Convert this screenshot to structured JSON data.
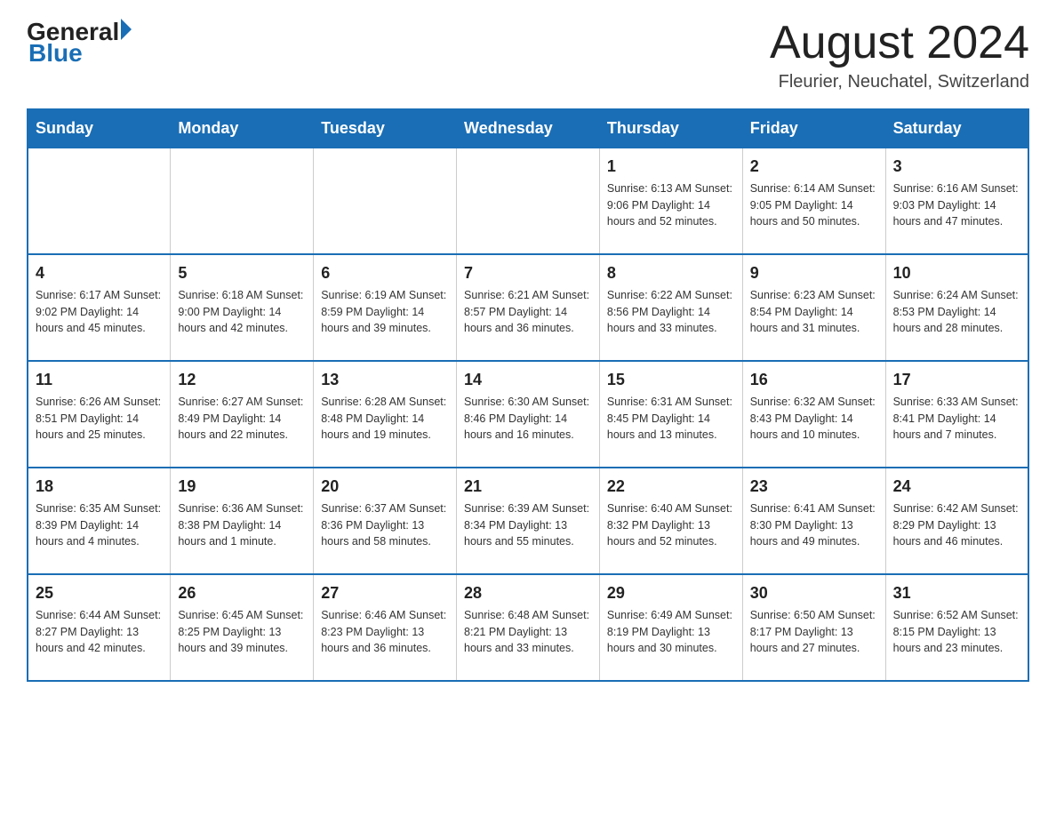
{
  "header": {
    "logo_general": "General",
    "logo_blue": "Blue",
    "month_title": "August 2024",
    "location": "Fleurier, Neuchatel, Switzerland"
  },
  "weekdays": [
    "Sunday",
    "Monday",
    "Tuesday",
    "Wednesday",
    "Thursday",
    "Friday",
    "Saturday"
  ],
  "weeks": [
    [
      {
        "day": "",
        "info": ""
      },
      {
        "day": "",
        "info": ""
      },
      {
        "day": "",
        "info": ""
      },
      {
        "day": "",
        "info": ""
      },
      {
        "day": "1",
        "info": "Sunrise: 6:13 AM\nSunset: 9:06 PM\nDaylight: 14 hours\nand 52 minutes."
      },
      {
        "day": "2",
        "info": "Sunrise: 6:14 AM\nSunset: 9:05 PM\nDaylight: 14 hours\nand 50 minutes."
      },
      {
        "day": "3",
        "info": "Sunrise: 6:16 AM\nSunset: 9:03 PM\nDaylight: 14 hours\nand 47 minutes."
      }
    ],
    [
      {
        "day": "4",
        "info": "Sunrise: 6:17 AM\nSunset: 9:02 PM\nDaylight: 14 hours\nand 45 minutes."
      },
      {
        "day": "5",
        "info": "Sunrise: 6:18 AM\nSunset: 9:00 PM\nDaylight: 14 hours\nand 42 minutes."
      },
      {
        "day": "6",
        "info": "Sunrise: 6:19 AM\nSunset: 8:59 PM\nDaylight: 14 hours\nand 39 minutes."
      },
      {
        "day": "7",
        "info": "Sunrise: 6:21 AM\nSunset: 8:57 PM\nDaylight: 14 hours\nand 36 minutes."
      },
      {
        "day": "8",
        "info": "Sunrise: 6:22 AM\nSunset: 8:56 PM\nDaylight: 14 hours\nand 33 minutes."
      },
      {
        "day": "9",
        "info": "Sunrise: 6:23 AM\nSunset: 8:54 PM\nDaylight: 14 hours\nand 31 minutes."
      },
      {
        "day": "10",
        "info": "Sunrise: 6:24 AM\nSunset: 8:53 PM\nDaylight: 14 hours\nand 28 minutes."
      }
    ],
    [
      {
        "day": "11",
        "info": "Sunrise: 6:26 AM\nSunset: 8:51 PM\nDaylight: 14 hours\nand 25 minutes."
      },
      {
        "day": "12",
        "info": "Sunrise: 6:27 AM\nSunset: 8:49 PM\nDaylight: 14 hours\nand 22 minutes."
      },
      {
        "day": "13",
        "info": "Sunrise: 6:28 AM\nSunset: 8:48 PM\nDaylight: 14 hours\nand 19 minutes."
      },
      {
        "day": "14",
        "info": "Sunrise: 6:30 AM\nSunset: 8:46 PM\nDaylight: 14 hours\nand 16 minutes."
      },
      {
        "day": "15",
        "info": "Sunrise: 6:31 AM\nSunset: 8:45 PM\nDaylight: 14 hours\nand 13 minutes."
      },
      {
        "day": "16",
        "info": "Sunrise: 6:32 AM\nSunset: 8:43 PM\nDaylight: 14 hours\nand 10 minutes."
      },
      {
        "day": "17",
        "info": "Sunrise: 6:33 AM\nSunset: 8:41 PM\nDaylight: 14 hours\nand 7 minutes."
      }
    ],
    [
      {
        "day": "18",
        "info": "Sunrise: 6:35 AM\nSunset: 8:39 PM\nDaylight: 14 hours\nand 4 minutes."
      },
      {
        "day": "19",
        "info": "Sunrise: 6:36 AM\nSunset: 8:38 PM\nDaylight: 14 hours\nand 1 minute."
      },
      {
        "day": "20",
        "info": "Sunrise: 6:37 AM\nSunset: 8:36 PM\nDaylight: 13 hours\nand 58 minutes."
      },
      {
        "day": "21",
        "info": "Sunrise: 6:39 AM\nSunset: 8:34 PM\nDaylight: 13 hours\nand 55 minutes."
      },
      {
        "day": "22",
        "info": "Sunrise: 6:40 AM\nSunset: 8:32 PM\nDaylight: 13 hours\nand 52 minutes."
      },
      {
        "day": "23",
        "info": "Sunrise: 6:41 AM\nSunset: 8:30 PM\nDaylight: 13 hours\nand 49 minutes."
      },
      {
        "day": "24",
        "info": "Sunrise: 6:42 AM\nSunset: 8:29 PM\nDaylight: 13 hours\nand 46 minutes."
      }
    ],
    [
      {
        "day": "25",
        "info": "Sunrise: 6:44 AM\nSunset: 8:27 PM\nDaylight: 13 hours\nand 42 minutes."
      },
      {
        "day": "26",
        "info": "Sunrise: 6:45 AM\nSunset: 8:25 PM\nDaylight: 13 hours\nand 39 minutes."
      },
      {
        "day": "27",
        "info": "Sunrise: 6:46 AM\nSunset: 8:23 PM\nDaylight: 13 hours\nand 36 minutes."
      },
      {
        "day": "28",
        "info": "Sunrise: 6:48 AM\nSunset: 8:21 PM\nDaylight: 13 hours\nand 33 minutes."
      },
      {
        "day": "29",
        "info": "Sunrise: 6:49 AM\nSunset: 8:19 PM\nDaylight: 13 hours\nand 30 minutes."
      },
      {
        "day": "30",
        "info": "Sunrise: 6:50 AM\nSunset: 8:17 PM\nDaylight: 13 hours\nand 27 minutes."
      },
      {
        "day": "31",
        "info": "Sunrise: 6:52 AM\nSunset: 8:15 PM\nDaylight: 13 hours\nand 23 minutes."
      }
    ]
  ]
}
